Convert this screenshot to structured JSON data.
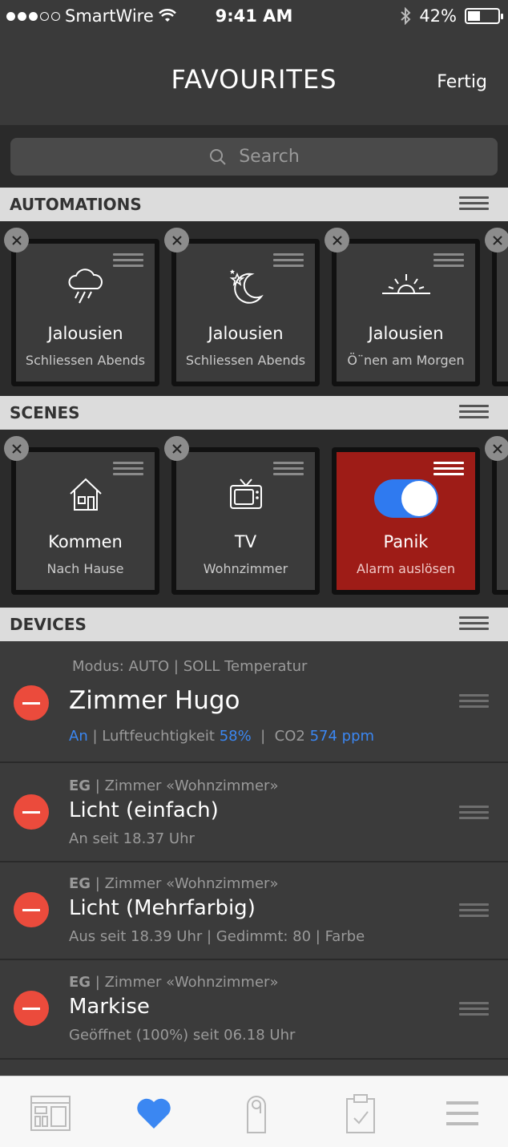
{
  "status": {
    "carrier": "SmartWire",
    "time": "9:41 AM",
    "battery": "42%"
  },
  "nav": {
    "title": "FAVOURITES",
    "done_label": "Fertig"
  },
  "search": {
    "placeholder": "Search"
  },
  "sections": {
    "automations": "AUTOMATIONS",
    "scenes": "SCENES",
    "devices": "DEVICES"
  },
  "automations": [
    {
      "icon": "rain-cloud-icon",
      "title": "Jalousien",
      "subtitle": "Schliessen Abends"
    },
    {
      "icon": "moon-stars-icon",
      "title": "Jalousien",
      "subtitle": "Schliessen Abends"
    },
    {
      "icon": "sunrise-icon",
      "title": "Jalousien",
      "subtitle": "Ö¨nen am Morgen"
    }
  ],
  "scenes": [
    {
      "icon": "house-icon",
      "title": "Kommen",
      "subtitle": "Nach Hause"
    },
    {
      "icon": "tv-icon",
      "title": "TV",
      "subtitle": "Wohnzimmer"
    },
    {
      "icon": "toggle-icon",
      "title": "Panik",
      "subtitle": "Alarm auslösen",
      "active": true
    }
  ],
  "devices": [
    {
      "super": "Modus: AUTO | SOLL Temperatur",
      "name": "Zimmer Hugo",
      "sub_state": "An",
      "sub_label1": " | Luftfeuchtigkeit ",
      "humidity": "58%",
      "sub_label2": "  |  CO2 ",
      "co2": "574 ppm"
    },
    {
      "floor": "EG",
      "room": " | Zimmer «Wohnzimmer»",
      "name": "Licht (einfach)",
      "sub": "An seit 18.37 Uhr"
    },
    {
      "floor": "EG",
      "room": " | Zimmer «Wohnzimmer»",
      "name": "Licht (Mehrfarbig)",
      "sub": "Aus seit 18.39 Uhr | Gedimmt: 80 | Farbe"
    },
    {
      "floor": "EG",
      "room": " | Zimmer «Wohnzimmer»",
      "name": "Markise",
      "sub": "Geöffnet (100%) seit 06.18 Uhr"
    }
  ],
  "tabbar": {
    "items": [
      "dashboard-icon",
      "heart-icon",
      "door-hanger-icon",
      "clipboard-icon",
      "menu-icon"
    ],
    "active": "heart-icon",
    "accent": "#3b87f2"
  }
}
